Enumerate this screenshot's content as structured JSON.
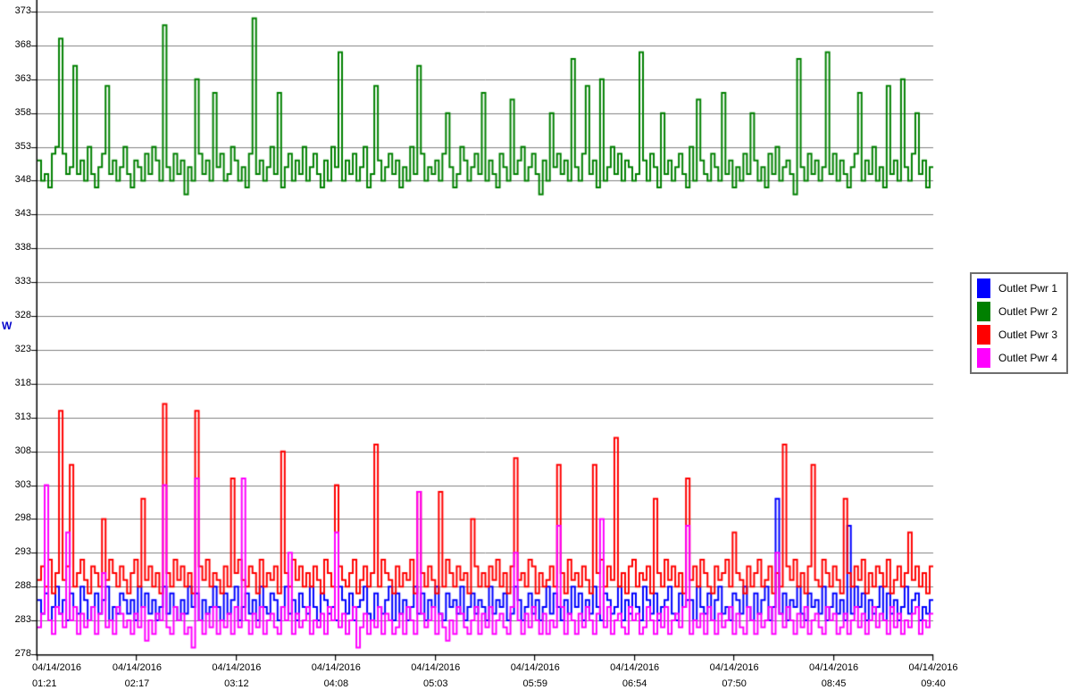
{
  "chart_data": {
    "type": "line",
    "step": true,
    "title": "",
    "ylabel": "W",
    "ylabel_color": "#0000cc",
    "ylim": [
      278,
      373
    ],
    "y_ticks": [
      278,
      283,
      288,
      293,
      298,
      303,
      308,
      313,
      318,
      323,
      328,
      333,
      338,
      343,
      348,
      353,
      358,
      363,
      368,
      373
    ],
    "grid": "horizontal",
    "grid_color": "#808080",
    "legend_position": "right",
    "x_ticks": [
      {
        "date": "04/14/2016",
        "time": "01:21"
      },
      {
        "date": "04/14/2016",
        "time": "02:17"
      },
      {
        "date": "04/14/2016",
        "time": "03:12"
      },
      {
        "date": "04/14/2016",
        "time": "04:08"
      },
      {
        "date": "04/14/2016",
        "time": "05:03"
      },
      {
        "date": "04/14/2016",
        "time": "05:59"
      },
      {
        "date": "04/14/2016",
        "time": "06:54"
      },
      {
        "date": "04/14/2016",
        "time": "07:50"
      },
      {
        "date": "04/14/2016",
        "time": "08:45"
      },
      {
        "date": "04/14/2016",
        "time": "09:40"
      }
    ],
    "series": [
      {
        "name": "Outlet Pwr 1",
        "color": "#0000ff",
        "values": [
          286,
          284,
          287,
          283,
          285,
          288,
          284,
          286,
          283,
          287,
          285,
          284,
          288,
          286,
          283,
          285,
          287,
          284,
          286,
          288,
          283,
          285,
          284,
          287,
          286,
          284,
          286,
          283,
          288,
          285,
          287,
          284,
          286,
          283,
          285,
          288,
          284,
          287,
          285,
          283,
          286,
          284,
          288,
          285,
          287,
          283,
          286,
          284,
          285,
          288,
          285,
          283,
          287,
          284,
          286,
          288,
          283,
          285,
          287,
          284,
          286,
          283,
          288,
          285,
          284,
          287,
          286,
          283,
          285,
          288,
          284,
          286,
          283,
          287,
          285,
          284,
          288,
          285,
          283,
          287,
          286,
          284,
          285,
          283,
          288,
          286,
          284,
          287,
          283,
          285,
          286,
          288,
          284,
          283,
          287,
          285,
          284,
          286,
          288,
          283,
          287,
          284,
          286,
          283,
          285,
          288,
          284,
          287,
          283,
          286,
          285,
          288,
          284,
          283,
          287,
          285,
          286,
          284,
          288,
          283,
          285,
          287,
          284,
          286,
          285,
          283,
          288,
          284,
          286,
          285,
          287,
          283,
          284,
          288,
          286,
          283,
          285,
          287,
          284,
          286,
          283,
          285,
          288,
          284,
          287,
          285,
          283,
          286,
          284,
          288,
          285,
          287,
          283,
          286,
          284,
          288,
          285,
          283,
          287,
          286,
          284,
          285,
          288,
          283,
          286,
          284,
          287,
          285,
          283,
          288,
          286,
          284,
          287,
          283,
          285,
          286,
          288,
          284,
          283,
          287,
          285,
          286,
          286,
          283,
          288,
          285,
          284,
          287,
          283,
          286,
          288,
          284,
          285,
          283,
          287,
          286,
          284,
          288,
          285,
          283,
          287,
          284,
          286,
          288,
          283,
          285,
          301,
          284,
          287,
          283,
          286,
          285,
          288,
          284,
          283,
          287,
          285,
          286,
          284,
          288,
          283,
          285,
          287,
          284,
          286,
          283,
          297,
          284,
          288,
          285,
          287,
          283,
          286,
          284,
          285,
          288,
          283,
          287,
          284,
          286,
          283,
          285,
          288,
          284,
          286,
          287,
          283,
          285,
          284,
          286
        ]
      },
      {
        "name": "Outlet Pwr 2",
        "color": "#008000",
        "values": [
          351,
          348,
          349,
          347,
          352,
          353,
          369,
          352,
          349,
          350,
          365,
          349,
          351,
          348,
          353,
          349,
          347,
          350,
          352,
          362,
          349,
          351,
          348,
          350,
          353,
          349,
          347,
          351,
          350,
          348,
          352,
          349,
          353,
          351,
          348,
          371,
          350,
          348,
          352,
          349,
          351,
          346,
          350,
          348,
          363,
          352,
          349,
          351,
          348,
          361,
          350,
          352,
          348,
          349,
          353,
          351,
          348,
          350,
          347,
          352,
          372,
          349,
          351,
          348,
          350,
          353,
          349,
          361,
          347,
          350,
          352,
          348,
          351,
          349,
          353,
          348,
          350,
          352,
          349,
          347,
          351,
          348,
          353,
          350,
          367,
          348,
          351,
          349,
          352,
          348,
          350,
          353,
          347,
          349,
          362,
          351,
          348,
          350,
          352,
          349,
          351,
          347,
          350,
          348,
          353,
          349,
          365,
          352,
          348,
          350,
          349,
          351,
          348,
          352,
          358,
          350,
          347,
          349,
          353,
          351,
          348,
          350,
          352,
          349,
          361,
          348,
          351,
          349,
          347,
          352,
          350,
          348,
          360,
          349,
          351,
          353,
          348,
          350,
          352,
          349,
          346,
          351,
          348,
          358,
          350,
          352,
          349,
          351,
          348,
          366,
          350,
          348,
          352,
          362,
          349,
          351,
          347,
          363,
          348,
          350,
          353,
          349,
          352,
          348,
          351,
          350,
          348,
          349,
          367,
          351,
          348,
          352,
          350,
          347,
          358,
          349,
          351,
          348,
          350,
          352,
          349,
          347,
          353,
          348,
          360,
          351,
          349,
          348,
          352,
          350,
          348,
          361,
          349,
          351,
          347,
          350,
          348,
          352,
          349,
          358,
          351,
          348,
          350,
          347,
          352,
          349,
          353,
          348,
          350,
          351,
          349,
          346,
          366,
          350,
          348,
          352,
          349,
          351,
          348,
          350,
          367,
          349,
          352,
          348,
          351,
          349,
          347,
          350,
          352,
          361,
          348,
          351,
          349,
          353,
          348,
          350,
          347,
          362,
          349,
          351,
          348,
          363,
          350,
          348,
          352,
          358,
          349,
          351,
          347,
          350
        ]
      },
      {
        "name": "Outlet Pwr 3",
        "color": "#ff0000",
        "values": [
          289,
          291,
          288,
          292,
          287,
          290,
          314,
          289,
          291,
          306,
          288,
          290,
          292,
          289,
          287,
          291,
          290,
          288,
          298,
          289,
          292,
          290,
          288,
          291,
          289,
          287,
          290,
          292,
          288,
          301,
          289,
          291,
          288,
          290,
          287,
          315,
          290,
          288,
          292,
          289,
          291,
          288,
          290,
          287,
          314,
          291,
          289,
          292,
          288,
          290,
          289,
          287,
          291,
          288,
          304,
          290,
          292,
          289,
          288,
          291,
          290,
          287,
          292,
          288,
          290,
          289,
          291,
          287,
          308,
          290,
          288,
          292,
          289,
          291,
          288,
          290,
          288,
          291,
          289,
          287,
          292,
          290,
          288,
          303,
          291,
          289,
          288,
          290,
          292,
          287,
          289,
          291,
          288,
          290,
          309,
          288,
          292,
          290,
          289,
          287,
          291,
          288,
          290,
          289,
          292,
          287,
          302,
          290,
          288,
          291,
          289,
          287,
          302,
          288,
          292,
          290,
          288,
          291,
          289,
          290,
          287,
          298,
          291,
          288,
          290,
          288,
          291,
          289,
          292,
          288,
          290,
          287,
          291,
          307,
          289,
          290,
          288,
          292,
          291,
          287,
          290,
          288,
          289,
          291,
          288,
          306,
          290,
          287,
          292,
          289,
          290,
          288,
          291,
          289,
          287,
          306,
          290,
          292,
          288,
          291,
          289,
          310,
          288,
          290,
          287,
          291,
          292,
          288,
          290,
          289,
          291,
          287,
          301,
          290,
          288,
          292,
          289,
          291,
          288,
          290,
          287,
          304,
          289,
          291,
          288,
          292,
          290,
          288,
          287,
          291,
          289,
          290,
          292,
          288,
          296,
          290,
          289,
          287,
          291,
          288,
          290,
          292,
          288,
          289,
          291,
          287,
          290,
          288,
          309,
          291,
          289,
          292,
          288,
          290,
          287,
          291,
          306,
          289,
          288,
          292,
          290,
          288,
          291,
          289,
          287,
          301,
          290,
          288,
          291,
          289,
          292,
          287,
          290,
          288,
          291,
          290,
          288,
          292,
          287,
          289,
          291,
          288,
          290,
          296,
          289,
          291,
          288,
          290,
          287,
          291
        ]
      },
      {
        "name": "Outlet Pwr 4",
        "color": "#ff00ff",
        "values": [
          282,
          284,
          303,
          283,
          281,
          285,
          284,
          282,
          296,
          283,
          285,
          281,
          284,
          282,
          283,
          285,
          281,
          284,
          290,
          282,
          283,
          281,
          285,
          284,
          282,
          283,
          281,
          284,
          282,
          285,
          280,
          283,
          281,
          284,
          283,
          303,
          282,
          281,
          285,
          283,
          284,
          281,
          282,
          279,
          304,
          283,
          281,
          284,
          282,
          285,
          281,
          283,
          282,
          284,
          281,
          285,
          282,
          304,
          283,
          281,
          284,
          282,
          285,
          281,
          283,
          284,
          282,
          281,
          285,
          283,
          293,
          281,
          284,
          282,
          283,
          285,
          281,
          283,
          282,
          284,
          281,
          285,
          283,
          296,
          282,
          284,
          281,
          283,
          285,
          279,
          282,
          284,
          281,
          283,
          282,
          285,
          281,
          284,
          283,
          281,
          282,
          284,
          281,
          285,
          283,
          281,
          302,
          284,
          282,
          283,
          285,
          281,
          284,
          282,
          280,
          283,
          281,
          285,
          284,
          282,
          281,
          283,
          285,
          281,
          284,
          282,
          285,
          281,
          283,
          284,
          282,
          281,
          285,
          293,
          283,
          281,
          284,
          282,
          285,
          283,
          281,
          284,
          281,
          283,
          282,
          297,
          285,
          281,
          284,
          283,
          281,
          284,
          282,
          285,
          283,
          281,
          284,
          298,
          282,
          285,
          281,
          283,
          284,
          282,
          281,
          285,
          283,
          284,
          281,
          282,
          285,
          283,
          281,
          284,
          282,
          285,
          281,
          283,
          284,
          282,
          285,
          297,
          281,
          283,
          282,
          284,
          281,
          285,
          283,
          281,
          284,
          282,
          283,
          285,
          281,
          284,
          282,
          281,
          285,
          283,
          281,
          284,
          282,
          283,
          285,
          281,
          293,
          284,
          282,
          285,
          283,
          281,
          284,
          282,
          285,
          281,
          283,
          284,
          282,
          281,
          285,
          283,
          284,
          281,
          282,
          284,
          281,
          283,
          285,
          282,
          284,
          281,
          283,
          285,
          282,
          284,
          283,
          281,
          285,
          282,
          284,
          281,
          283,
          282,
          284,
          285,
          281,
          283,
          282,
          284
        ]
      }
    ]
  }
}
